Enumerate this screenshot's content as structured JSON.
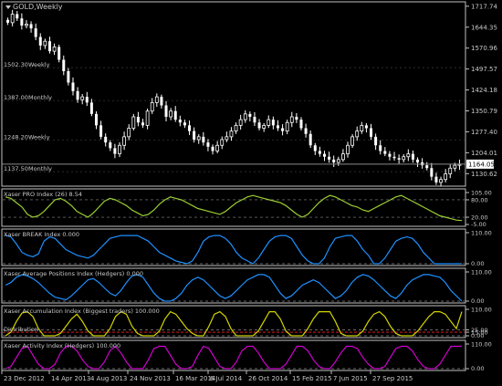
{
  "window": {
    "title": "GOLD,Weekly"
  },
  "colors": {
    "background": "#000000",
    "frame": "#c0c0c0",
    "grid": "#3c3c3c",
    "label": "#c8c8c8",
    "bull": "#ffffff",
    "bear": "#ffffff",
    "current_price_line": "#8a8a8a",
    "pro": "#9acd32",
    "break": "#1e90ff",
    "avg": "#1e90ff",
    "accum": "#d4d400",
    "level_red": "#ff2020",
    "activity": "#d000d0",
    "dashed": "#8a8a8a"
  },
  "price_panel": {
    "ticks": [
      "1717.74",
      "1644.35",
      "1570.96",
      "1497.57",
      "1424.18",
      "1350.79",
      "1277.40",
      "1204.01",
      "1130.62"
    ],
    "current_price": "1164.05",
    "levels": [
      {
        "price": "1502.30",
        "period": "Weekly"
      },
      {
        "price": "1387.00",
        "period": "Monthly"
      },
      {
        "price": "1248.20",
        "period": "Weekly"
      },
      {
        "price": "1137.50",
        "period": "Monthly"
      }
    ]
  },
  "indicators": [
    {
      "id": "pro",
      "label": "Xaser PRO Index (26) 8.54",
      "ticks": [
        "105.00",
        "80.00",
        "20.00",
        "-5.00"
      ]
    },
    {
      "id": "break",
      "label": "Xaser BREAK Index 0.000",
      "ticks": [
        "110.00",
        "0.00"
      ]
    },
    {
      "id": "avg",
      "label": "Xaser Average Positions Index (Hedgers) 0.000",
      "ticks": [
        "110.00",
        "0.00"
      ]
    },
    {
      "id": "accum",
      "label": "Xaser Accumulation Index (Biggest traders) 100.000",
      "ticks": [
        "110.00",
        "25.00",
        "15.00",
        "0.00"
      ],
      "zone_label": "Distribution"
    },
    {
      "id": "activity",
      "label": "Xaser Activity Index (Hedgers) 100.000",
      "ticks": [
        "110.00",
        "0.00"
      ]
    }
  ],
  "x_axis": {
    "labels": [
      "23 Dec 2012",
      "14 Apr 2013",
      "4 Aug 2013",
      "24 Nov 2013",
      "16 Mar 2014",
      "6 Jul 2014",
      "26 Oct 2014",
      "15 Feb 2015",
      "7 Jun 2015",
      "27 Sep 2015"
    ]
  },
  "chart_data": [
    {
      "type": "candlestick",
      "title": "GOLD,Weekly",
      "ylim": [
        1090,
        1730
      ],
      "y_ticks": [
        1717.74,
        1644.35,
        1570.96,
        1497.57,
        1424.18,
        1350.79,
        1277.4,
        1204.01,
        1130.62
      ],
      "current_price": 1164.05,
      "close": [
        1660,
        1690,
        1675,
        1650,
        1655,
        1640,
        1610,
        1580,
        1595,
        1560,
        1575,
        1530,
        1490,
        1450,
        1420,
        1390,
        1400,
        1380,
        1340,
        1300,
        1260,
        1240,
        1220,
        1200,
        1230,
        1260,
        1290,
        1330,
        1310,
        1300,
        1350,
        1380,
        1400,
        1370,
        1330,
        1350,
        1320,
        1310,
        1300,
        1280,
        1250,
        1260,
        1240,
        1225,
        1210,
        1230,
        1250,
        1260,
        1280,
        1300,
        1320,
        1340,
        1330,
        1310,
        1290,
        1300,
        1320,
        1300,
        1290,
        1280,
        1310,
        1330,
        1320,
        1290,
        1270,
        1230,
        1210,
        1200,
        1190,
        1180,
        1170,
        1180,
        1200,
        1230,
        1260,
        1280,
        1300,
        1290,
        1260,
        1230,
        1210,
        1200,
        1190,
        1185,
        1180,
        1190,
        1200,
        1180,
        1170,
        1160,
        1150,
        1120,
        1100,
        1110,
        1130,
        1150,
        1160,
        1164.05
      ]
    },
    {
      "type": "line",
      "title": "Xaser PRO Index (26) 8.54",
      "ylim": [
        -5,
        105
      ],
      "values": [
        90,
        85,
        70,
        55,
        30,
        20,
        25,
        40,
        60,
        80,
        85,
        75,
        60,
        40,
        30,
        20,
        35,
        55,
        75,
        85,
        80,
        70,
        60,
        45,
        35,
        25,
        30,
        45,
        65,
        80,
        90,
        85,
        80,
        70,
        60,
        50,
        45,
        40,
        35,
        30,
        40,
        55,
        70,
        80,
        90,
        95,
        90,
        85,
        80,
        75,
        70,
        60,
        45,
        30,
        20,
        30,
        50,
        70,
        85,
        95,
        90,
        80,
        70,
        60,
        55,
        45,
        40,
        50,
        60,
        70,
        80,
        90,
        95,
        85,
        75,
        65,
        55,
        45,
        35,
        25,
        20,
        15,
        10,
        8.54
      ]
    },
    {
      "type": "line",
      "title": "Xaser BREAK Index 0.000",
      "ylim": [
        0,
        110
      ],
      "values": [
        100,
        95,
        70,
        40,
        30,
        25,
        35,
        80,
        95,
        90,
        70,
        50,
        40,
        30,
        25,
        20,
        30,
        50,
        70,
        90,
        95,
        100,
        100,
        100,
        100,
        90,
        80,
        60,
        40,
        30,
        20,
        10,
        5,
        0,
        10,
        40,
        80,
        95,
        100,
        100,
        90,
        70,
        40,
        20,
        10,
        0,
        20,
        50,
        80,
        95,
        100,
        100,
        90,
        60,
        30,
        10,
        0,
        0,
        20,
        60,
        90,
        95,
        100,
        100,
        80,
        50,
        30,
        0,
        0,
        20,
        50,
        80,
        90,
        95,
        90,
        70,
        40,
        20,
        0,
        0,
        0,
        0,
        0,
        0
      ]
    },
    {
      "type": "line",
      "title": "Xaser Average Positions Index (Hedgers) 0.000",
      "ylim": [
        0,
        110
      ],
      "values": [
        60,
        70,
        90,
        100,
        95,
        85,
        70,
        50,
        30,
        15,
        10,
        5,
        20,
        40,
        60,
        80,
        85,
        70,
        50,
        30,
        20,
        40,
        70,
        95,
        100,
        90,
        60,
        30,
        10,
        0,
        0,
        10,
        30,
        60,
        80,
        90,
        80,
        60,
        40,
        20,
        10,
        20,
        40,
        60,
        80,
        90,
        100,
        100,
        90,
        60,
        30,
        10,
        20,
        40,
        60,
        70,
        80,
        70,
        50,
        30,
        10,
        20,
        40,
        70,
        90,
        100,
        95,
        80,
        60,
        40,
        20,
        10,
        30,
        60,
        80,
        90,
        100,
        100,
        95,
        90,
        70,
        40,
        20,
        0
      ]
    },
    {
      "type": "line",
      "title": "Xaser Accumulation Index (Biggest traders) 100.000",
      "ylim": [
        0,
        110
      ],
      "values": [
        0,
        15,
        60,
        95,
        100,
        80,
        30,
        0,
        0,
        0,
        10,
        40,
        70,
        90,
        60,
        20,
        0,
        0,
        0,
        30,
        80,
        100,
        90,
        40,
        10,
        0,
        0,
        0,
        20,
        70,
        100,
        90,
        60,
        30,
        10,
        0,
        0,
        40,
        90,
        100,
        80,
        30,
        0,
        0,
        0,
        0,
        20,
        60,
        100,
        100,
        70,
        20,
        0,
        0,
        0,
        30,
        70,
        100,
        100,
        100,
        60,
        10,
        0,
        0,
        0,
        20,
        60,
        90,
        100,
        80,
        40,
        10,
        0,
        0,
        0,
        20,
        50,
        80,
        100,
        100,
        90,
        60,
        30,
        100
      ]
    },
    {
      "type": "line",
      "title": "Xaser Activity Index (Hedgers) 100.000",
      "ylim": [
        0,
        110
      ],
      "values": [
        0,
        10,
        50,
        90,
        100,
        60,
        20,
        0,
        0,
        20,
        70,
        100,
        100,
        80,
        40,
        10,
        0,
        0,
        30,
        80,
        100,
        70,
        30,
        0,
        0,
        0,
        40,
        90,
        100,
        100,
        60,
        20,
        0,
        0,
        10,
        60,
        100,
        90,
        50,
        10,
        0,
        0,
        30,
        80,
        100,
        100,
        70,
        30,
        0,
        0,
        0,
        20,
        60,
        100,
        100,
        80,
        40,
        10,
        0,
        0,
        30,
        70,
        100,
        100,
        90,
        50,
        20,
        0,
        0,
        10,
        50,
        90,
        100,
        100,
        80,
        40,
        10,
        0,
        0,
        20,
        60,
        100,
        100,
        100
      ]
    }
  ]
}
